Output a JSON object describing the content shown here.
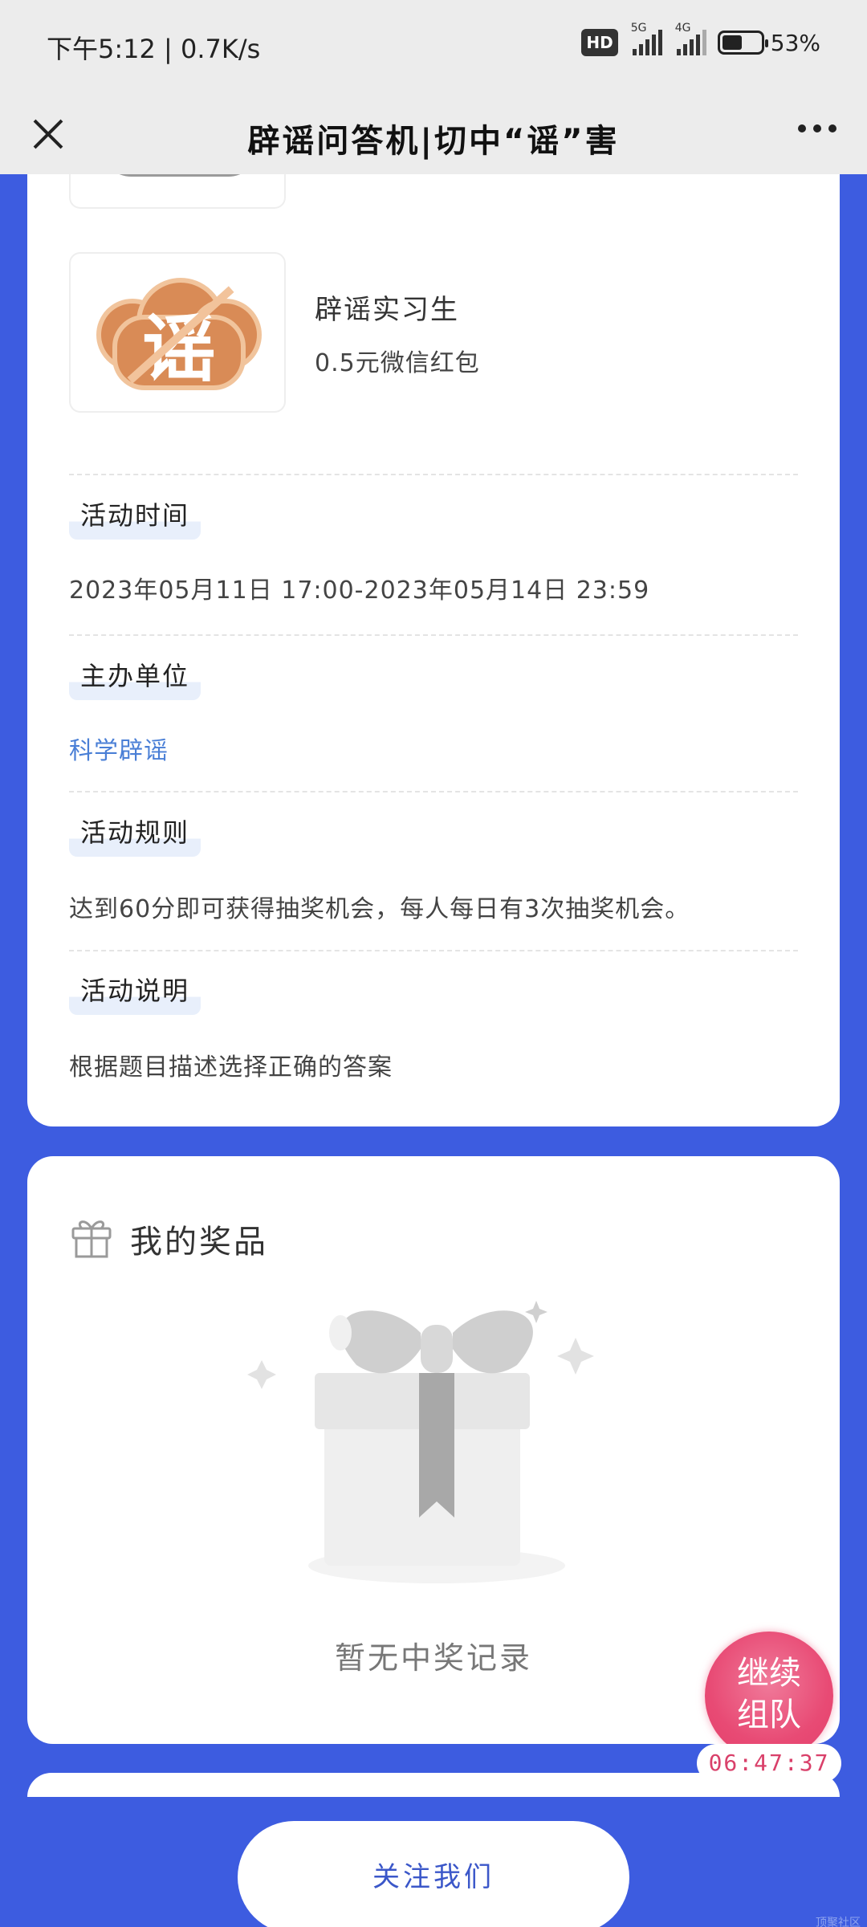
{
  "status_bar": {
    "time_speed": "下午5:12 | 0.7K/s",
    "hd_badge": "HD",
    "signal1_label": "5G",
    "signal2_label": "4G",
    "battery_percent": "53%",
    "battery_level": 0.53
  },
  "title_bar": {
    "title": "辟谣问答机|切中“谣”害"
  },
  "prizes": [
    {
      "name": "辟谣实习生",
      "desc": "0.5元微信红包",
      "badge_char": "谣"
    }
  ],
  "sections": [
    {
      "label": "活动时间",
      "value": "2023年05月11日 17:00-2023年05月14日 23:59"
    },
    {
      "label": "主办单位",
      "value": "科学辟谣"
    },
    {
      "label": "活动规则",
      "value": "达到60分即可获得抽奖机会，每人每日有3次抽奖机会。"
    },
    {
      "label": "活动说明",
      "value": "根据题目描述选择正确的答案"
    }
  ],
  "my_prizes": {
    "title": "我的奖品",
    "empty_text": "暂无中奖记录"
  },
  "team_float": {
    "line1": "继续",
    "line2": "组队",
    "timer": "06:47:37"
  },
  "follow_button": "关注我们",
  "corner_mark": "顶聚社区"
}
